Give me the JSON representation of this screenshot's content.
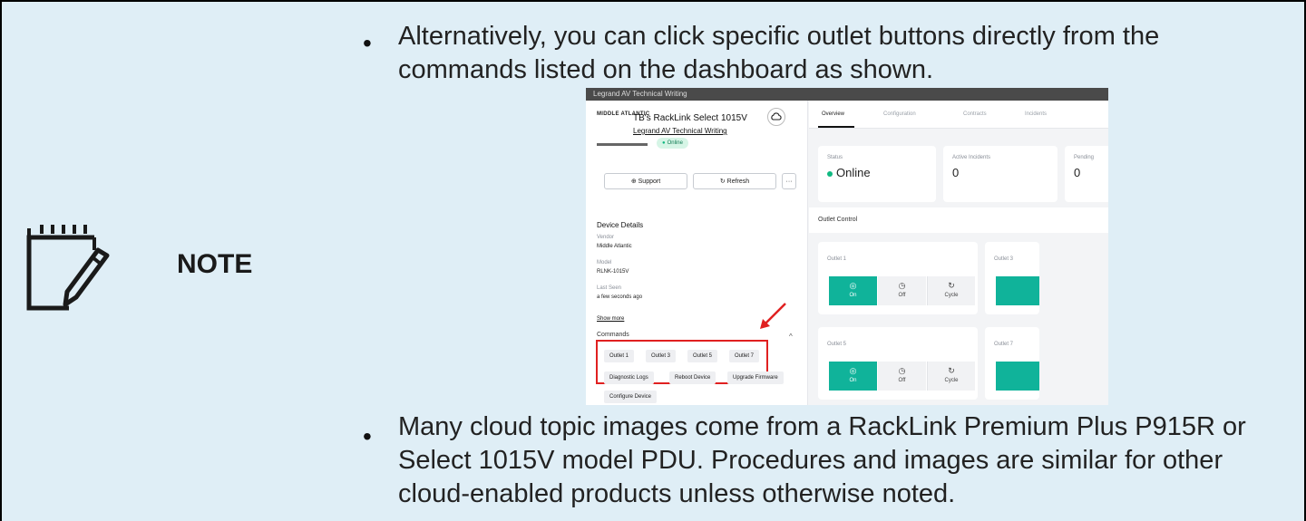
{
  "note": {
    "label": "NOTE",
    "bullet_symbol": "•",
    "bullets": [
      "Alternatively, you can click specific outlet buttons directly from the commands listed on the dashboard as shown.",
      "Many cloud topic images come from a RackLink Premium Plus P915R or Select 1015V model PDU. Procedures and images are similar for other cloud-enabled products unless otherwise noted."
    ]
  },
  "screenshot": {
    "topbar_title": "Legrand AV Technical Writing",
    "logo": "MIDDLE ATLANTIC",
    "device_name": "TB's RackLink Select 1015V",
    "org_link": "Legrand AV Technical Writing",
    "status_pill": "Online",
    "support_button": "Support",
    "refresh_button": "Refresh",
    "more_button": "···",
    "device_details": {
      "title": "Device Details",
      "vendor_label": "Vendor",
      "vendor_value": "Middle Atlantic",
      "model_label": "Model",
      "model_value": "RLNK-1015V",
      "last_seen_label": "Last Seen",
      "last_seen_value": "a few seconds ago",
      "show_more": "Show more"
    },
    "commands": {
      "title": "Commands",
      "outlets": [
        "Outlet 1",
        "Outlet 3",
        "Outlet 5",
        "Outlet 7"
      ],
      "actions": [
        "Diagnostic Logs",
        "Reboot Device",
        "Upgrade Firmware",
        "Configure Device"
      ]
    },
    "tabs": [
      "Overview",
      "Configuration",
      "Contracts",
      "Incidents"
    ],
    "stats": {
      "status_label": "Status",
      "status_value": "Online",
      "incidents_label": "Active Incidents",
      "incidents_value": "0",
      "pending_label": "Pending",
      "pending_value": "0"
    },
    "outlet_control": {
      "title": "Outlet Control",
      "cards": [
        "Outlet 1",
        "Outlet 3",
        "Outlet 5",
        "Outlet 7"
      ],
      "on_label": "On",
      "off_label": "Off",
      "cycle_label": "Cycle"
    },
    "colors": {
      "accent": "#10b39a",
      "highlight": "#e02020",
      "status_online": "#10b981"
    }
  }
}
